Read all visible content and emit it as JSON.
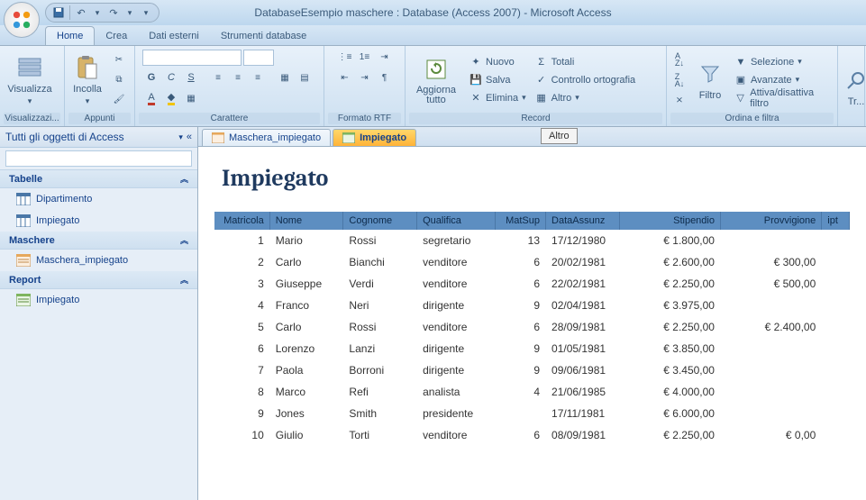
{
  "titlebar": {
    "title": "DatabaseEsempio maschere : Database (Access 2007) - Microsoft Access"
  },
  "ribbon": {
    "tabs": [
      "Home",
      "Crea",
      "Dati esterni",
      "Strumenti database"
    ],
    "groups": {
      "visualizzazioni": {
        "big": "Visualizza",
        "label": "Visualizzazi..."
      },
      "appunti": {
        "big": "Incolla",
        "label": "Appunti"
      },
      "carattere": {
        "label": "Carattere"
      },
      "formatortf": {
        "label": "Formato RTF"
      },
      "record": {
        "big": "Aggiorna tutto",
        "nuovo": "Nuovo",
        "salva": "Salva",
        "elimina": "Elimina",
        "totali": "Totali",
        "ortografia": "Controllo ortografia",
        "altro": "Altro",
        "label": "Record"
      },
      "ordina": {
        "filtro": "Filtro",
        "selezione": "Selezione",
        "avanzate": "Avanzate",
        "attiva": "Attiva/disattiva filtro",
        "label": "Ordina e filtra"
      },
      "trova": {
        "big": "Tr..."
      }
    }
  },
  "altro_box": "Altro",
  "nav": {
    "header": "Tutti gli oggetti di Access",
    "sections": {
      "tabelle": {
        "title": "Tabelle",
        "items": [
          "Dipartimento",
          "Impiegato"
        ]
      },
      "maschere": {
        "title": "Maschere",
        "items": [
          "Maschera_impiegato"
        ]
      },
      "report": {
        "title": "Report",
        "items": [
          "Impiegato"
        ]
      }
    }
  },
  "doc": {
    "tabs": [
      {
        "label": "Maschera_impiegato",
        "active": false
      },
      {
        "label": "Impiegato",
        "active": true
      }
    ],
    "title": "Impiegato",
    "columns": [
      "Matricola",
      "Nome",
      "Cognome",
      "Qualifica",
      "MatSup",
      "DataAssunz",
      "Stipendio",
      "Provvigione",
      "ipt"
    ],
    "rows": [
      {
        "Matricola": "1",
        "Nome": "Mario",
        "Cognome": "Rossi",
        "Qualifica": "segretario",
        "MatSup": "13",
        "DataAssunz": "17/12/1980",
        "Stipendio": "€ 1.800,00",
        "Provvigione": ""
      },
      {
        "Matricola": "2",
        "Nome": "Carlo",
        "Cognome": "Bianchi",
        "Qualifica": "venditore",
        "MatSup": "6",
        "DataAssunz": "20/02/1981",
        "Stipendio": "€ 2.600,00",
        "Provvigione": "€ 300,00"
      },
      {
        "Matricola": "3",
        "Nome": "Giuseppe",
        "Cognome": "Verdi",
        "Qualifica": "venditore",
        "MatSup": "6",
        "DataAssunz": "22/02/1981",
        "Stipendio": "€ 2.250,00",
        "Provvigione": "€ 500,00"
      },
      {
        "Matricola": "4",
        "Nome": "Franco",
        "Cognome": "Neri",
        "Qualifica": "dirigente",
        "MatSup": "9",
        "DataAssunz": "02/04/1981",
        "Stipendio": "€ 3.975,00",
        "Provvigione": ""
      },
      {
        "Matricola": "5",
        "Nome": "Carlo",
        "Cognome": "Rossi",
        "Qualifica": "venditore",
        "MatSup": "6",
        "DataAssunz": "28/09/1981",
        "Stipendio": "€ 2.250,00",
        "Provvigione": "€ 2.400,00"
      },
      {
        "Matricola": "6",
        "Nome": "Lorenzo",
        "Cognome": "Lanzi",
        "Qualifica": "dirigente",
        "MatSup": "9",
        "DataAssunz": "01/05/1981",
        "Stipendio": "€ 3.850,00",
        "Provvigione": ""
      },
      {
        "Matricola": "7",
        "Nome": "Paola",
        "Cognome": "Borroni",
        "Qualifica": "dirigente",
        "MatSup": "9",
        "DataAssunz": "09/06/1981",
        "Stipendio": "€ 3.450,00",
        "Provvigione": ""
      },
      {
        "Matricola": "8",
        "Nome": "Marco",
        "Cognome": "Refi",
        "Qualifica": "analista",
        "MatSup": "4",
        "DataAssunz": "21/06/1985",
        "Stipendio": "€ 4.000,00",
        "Provvigione": ""
      },
      {
        "Matricola": "9",
        "Nome": "Jones",
        "Cognome": "Smith",
        "Qualifica": "presidente",
        "MatSup": "",
        "DataAssunz": "17/11/1981",
        "Stipendio": "€ 6.000,00",
        "Provvigione": ""
      },
      {
        "Matricola": "10",
        "Nome": "Giulio",
        "Cognome": "Torti",
        "Qualifica": "venditore",
        "MatSup": "6",
        "DataAssunz": "08/09/1981",
        "Stipendio": "€ 2.250,00",
        "Provvigione": "€ 0,00"
      }
    ]
  }
}
